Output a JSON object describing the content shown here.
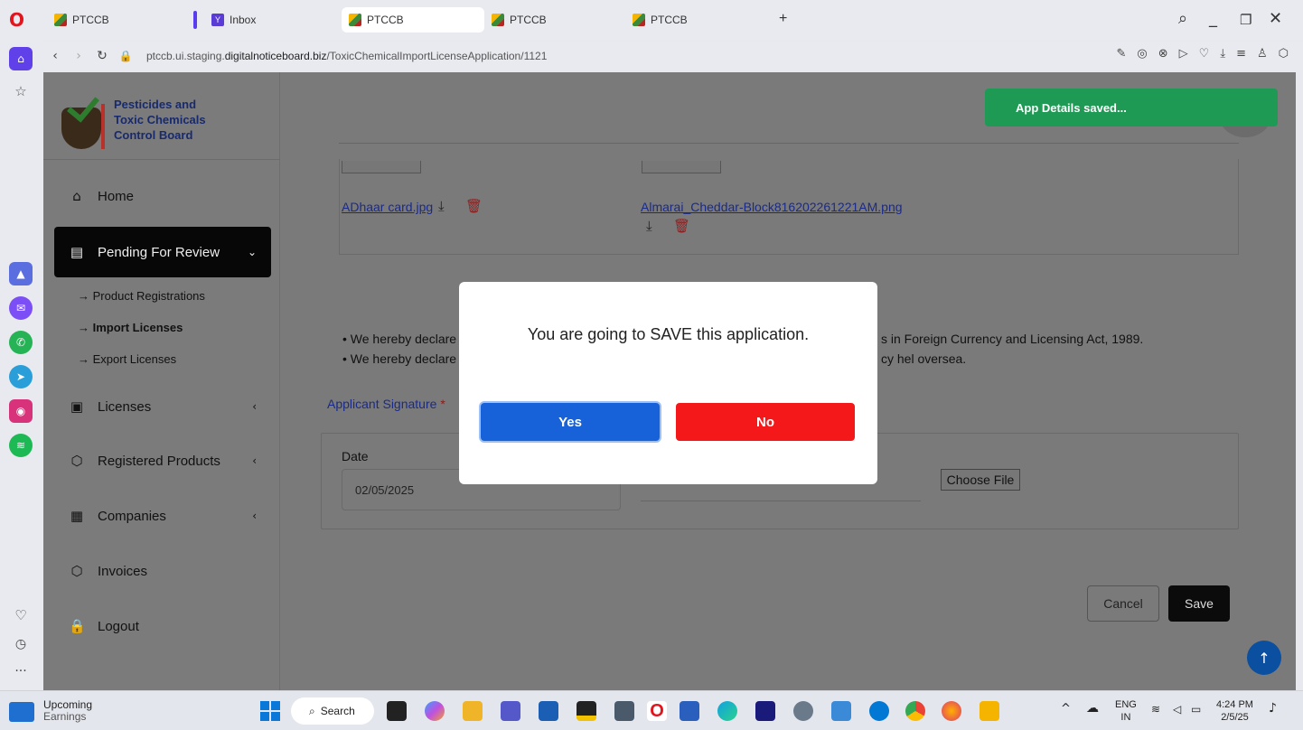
{
  "browser": {
    "tabs": [
      {
        "label": "PTCCB"
      },
      {
        "label": "Inbox"
      },
      {
        "label": "PTCCB"
      },
      {
        "label": "PTCCB"
      },
      {
        "label": "PTCCB"
      }
    ],
    "url_prefix": "ptccb.ui.staging.",
    "url_domain": "digitalnoticeboard.biz",
    "url_path": "/ToxicChemicalImportLicenseApplication/1121"
  },
  "sidebar": {
    "logo_line1": "Pesticides and",
    "logo_line2": "Toxic Chemicals",
    "logo_line3": "Control Board",
    "items": [
      {
        "label": "Home"
      },
      {
        "label": "Pending For Review"
      },
      {
        "label": "Licenses"
      },
      {
        "label": "Registered Products"
      },
      {
        "label": "Companies"
      },
      {
        "label": "Invoices"
      },
      {
        "label": "Logout"
      }
    ],
    "sub_items": [
      {
        "label": "Product Registrations"
      },
      {
        "label": "Import Licenses"
      },
      {
        "label": "Export Licenses"
      }
    ]
  },
  "attachments": {
    "file1": "ADhaar card.jpg",
    "file2": "Almarai_Cheddar-Block816202261221AM.png"
  },
  "declarations": {
    "line1_start": "We hereby declare",
    "line1_end": "s in Foreign Currency and Licensing Act, 1989.",
    "line2_start": "We hereby declare",
    "line2_end": "cy hel oversea."
  },
  "signature": {
    "label": "Applicant Signature",
    "required": "*",
    "date_label": "Date",
    "date_value": "02/05/2025",
    "choose_file": "Choose File"
  },
  "actions": {
    "cancel": "Cancel",
    "save": "Save"
  },
  "toast": {
    "message": "App Details saved..."
  },
  "modal": {
    "message": "You are going to SAVE this application.",
    "yes": "Yes",
    "no": "No"
  },
  "taskbar": {
    "widget_line1": "Upcoming",
    "widget_line2": "Earnings",
    "search": "Search",
    "lang1": "ENG",
    "lang2": "IN",
    "time": "4:24 PM",
    "date": "2/5/25"
  }
}
